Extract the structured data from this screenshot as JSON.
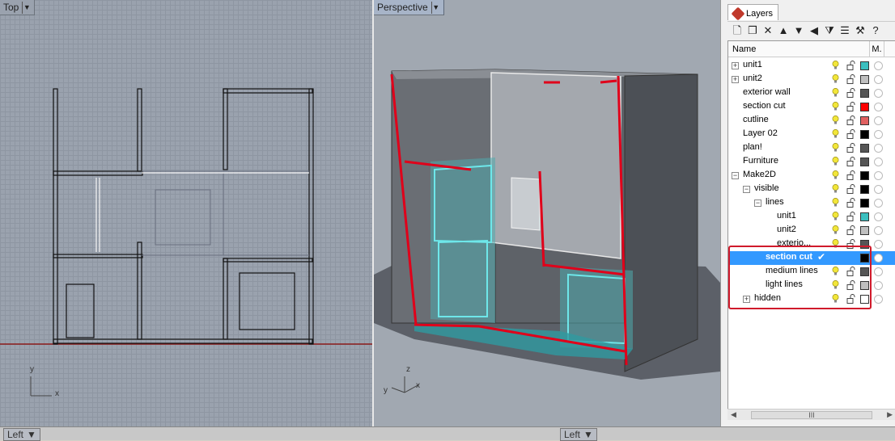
{
  "viewports": {
    "top": {
      "label": "Top",
      "axis_x": "x",
      "axis_y": "y"
    },
    "perspective": {
      "label": "Perspective",
      "axis_x": "x",
      "axis_y": "y",
      "axis_z": "z"
    }
  },
  "bottom_tabs": [
    {
      "label": "Left"
    },
    {
      "label": "Left"
    }
  ],
  "layers_panel": {
    "tab_label": "Layers",
    "columns": {
      "name": "Name",
      "material": "M."
    },
    "toolbar_icons": [
      "new-layer-icon",
      "new-sublayer-icon",
      "delete-icon",
      "move-up-icon",
      "move-down-icon",
      "move-to-parent-icon",
      "filter-icon",
      "properties-icon",
      "tools-icon",
      "help-icon"
    ],
    "scroll_label": "III",
    "layers": [
      {
        "name": "unit1",
        "depth": 0,
        "expandable": true,
        "expanded": false,
        "color": "#3bbfbf",
        "selected": false
      },
      {
        "name": "unit2",
        "depth": 0,
        "expandable": true,
        "expanded": false,
        "color": "#bfbfbf",
        "selected": false
      },
      {
        "name": "exterior wall",
        "depth": 0,
        "expandable": false,
        "color": "#555555",
        "selected": false
      },
      {
        "name": "section cut",
        "depth": 0,
        "expandable": false,
        "color": "#ff0000",
        "selected": false
      },
      {
        "name": "cutline",
        "depth": 0,
        "expandable": false,
        "color": "#e06060",
        "selected": false
      },
      {
        "name": "Layer 02",
        "depth": 0,
        "expandable": false,
        "color": "#000000",
        "selected": false
      },
      {
        "name": "plan!",
        "depth": 0,
        "expandable": false,
        "color": "#555555",
        "selected": false
      },
      {
        "name": "Furniture",
        "depth": 0,
        "expandable": false,
        "color": "#555555",
        "selected": false
      },
      {
        "name": "Make2D",
        "depth": 0,
        "expandable": true,
        "expanded": true,
        "color": "#000000",
        "selected": false
      },
      {
        "name": "visible",
        "depth": 1,
        "expandable": true,
        "expanded": true,
        "color": "#000000",
        "selected": false
      },
      {
        "name": "lines",
        "depth": 2,
        "expandable": true,
        "expanded": true,
        "color": "#000000",
        "selected": false
      },
      {
        "name": "unit1",
        "depth": 3,
        "expandable": false,
        "color": "#3bbfbf",
        "selected": false
      },
      {
        "name": "unit2",
        "depth": 3,
        "expandable": false,
        "color": "#bfbfbf",
        "selected": false
      },
      {
        "name": "exterio...",
        "depth": 3,
        "expandable": false,
        "color": "#555555",
        "selected": false
      },
      {
        "name": "section cut",
        "depth": 2,
        "expandable": false,
        "color": "#000000",
        "selected": true
      },
      {
        "name": "medium lines",
        "depth": 2,
        "expandable": false,
        "color": "#555555",
        "selected": false
      },
      {
        "name": "light lines",
        "depth": 2,
        "expandable": false,
        "color": "#bfbfbf",
        "selected": false
      },
      {
        "name": "hidden",
        "depth": 1,
        "expandable": true,
        "expanded": false,
        "color": "#ffffff",
        "selected": false
      }
    ]
  },
  "colors": {
    "accent_selection": "#3399ff",
    "highlight_box": "#d01a2b",
    "section_red": "#e0001a",
    "unit_cyan": "#3fd7d7"
  }
}
